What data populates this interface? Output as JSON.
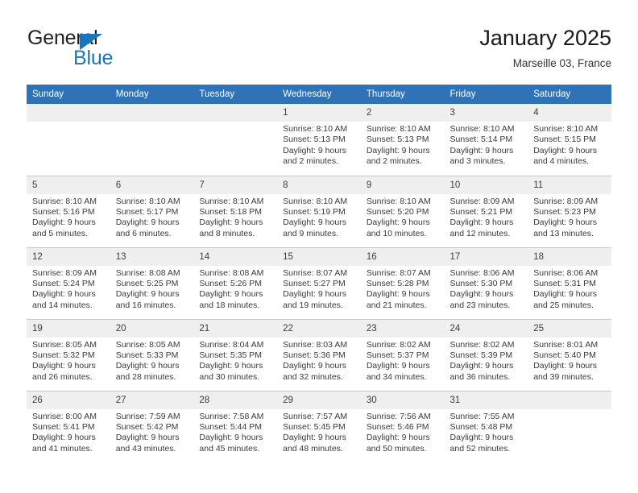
{
  "brand": {
    "name_top": "General",
    "name_bottom": "Blue",
    "triangle_icon": "blue-triangle-icon",
    "color_blue": "#1b75bb",
    "color_dark": "#222222"
  },
  "header": {
    "title": "January 2025",
    "subtitle": "Marseille 03, France"
  },
  "theme": {
    "header_bg": "#2f72b5",
    "header_text": "#ffffff",
    "daynum_bg": "#efefef",
    "cell_bg": "#ffffff",
    "row_divider": "#c7c7c7"
  },
  "weekdays": [
    "Sunday",
    "Monday",
    "Tuesday",
    "Wednesday",
    "Thursday",
    "Friday",
    "Saturday"
  ],
  "labels": {
    "sunrise_prefix": "Sunrise:",
    "sunset_prefix": "Sunset:",
    "daylight_prefix": "Daylight:"
  },
  "weeks": [
    [
      {
        "day": "",
        "empty": true
      },
      {
        "day": "",
        "empty": true
      },
      {
        "day": "",
        "empty": true
      },
      {
        "day": "1",
        "sunrise": "Sunrise: 8:10 AM",
        "sunset": "Sunset: 5:13 PM",
        "daylight_line1": "Daylight: 9 hours",
        "daylight_line2": "and 2 minutes."
      },
      {
        "day": "2",
        "sunrise": "Sunrise: 8:10 AM",
        "sunset": "Sunset: 5:13 PM",
        "daylight_line1": "Daylight: 9 hours",
        "daylight_line2": "and 2 minutes."
      },
      {
        "day": "3",
        "sunrise": "Sunrise: 8:10 AM",
        "sunset": "Sunset: 5:14 PM",
        "daylight_line1": "Daylight: 9 hours",
        "daylight_line2": "and 3 minutes."
      },
      {
        "day": "4",
        "sunrise": "Sunrise: 8:10 AM",
        "sunset": "Sunset: 5:15 PM",
        "daylight_line1": "Daylight: 9 hours",
        "daylight_line2": "and 4 minutes."
      }
    ],
    [
      {
        "day": "5",
        "sunrise": "Sunrise: 8:10 AM",
        "sunset": "Sunset: 5:16 PM",
        "daylight_line1": "Daylight: 9 hours",
        "daylight_line2": "and 5 minutes."
      },
      {
        "day": "6",
        "sunrise": "Sunrise: 8:10 AM",
        "sunset": "Sunset: 5:17 PM",
        "daylight_line1": "Daylight: 9 hours",
        "daylight_line2": "and 6 minutes."
      },
      {
        "day": "7",
        "sunrise": "Sunrise: 8:10 AM",
        "sunset": "Sunset: 5:18 PM",
        "daylight_line1": "Daylight: 9 hours",
        "daylight_line2": "and 8 minutes."
      },
      {
        "day": "8",
        "sunrise": "Sunrise: 8:10 AM",
        "sunset": "Sunset: 5:19 PM",
        "daylight_line1": "Daylight: 9 hours",
        "daylight_line2": "and 9 minutes."
      },
      {
        "day": "9",
        "sunrise": "Sunrise: 8:10 AM",
        "sunset": "Sunset: 5:20 PM",
        "daylight_line1": "Daylight: 9 hours",
        "daylight_line2": "and 10 minutes."
      },
      {
        "day": "10",
        "sunrise": "Sunrise: 8:09 AM",
        "sunset": "Sunset: 5:21 PM",
        "daylight_line1": "Daylight: 9 hours",
        "daylight_line2": "and 12 minutes."
      },
      {
        "day": "11",
        "sunrise": "Sunrise: 8:09 AM",
        "sunset": "Sunset: 5:23 PM",
        "daylight_line1": "Daylight: 9 hours",
        "daylight_line2": "and 13 minutes."
      }
    ],
    [
      {
        "day": "12",
        "sunrise": "Sunrise: 8:09 AM",
        "sunset": "Sunset: 5:24 PM",
        "daylight_line1": "Daylight: 9 hours",
        "daylight_line2": "and 14 minutes."
      },
      {
        "day": "13",
        "sunrise": "Sunrise: 8:08 AM",
        "sunset": "Sunset: 5:25 PM",
        "daylight_line1": "Daylight: 9 hours",
        "daylight_line2": "and 16 minutes."
      },
      {
        "day": "14",
        "sunrise": "Sunrise: 8:08 AM",
        "sunset": "Sunset: 5:26 PM",
        "daylight_line1": "Daylight: 9 hours",
        "daylight_line2": "and 18 minutes."
      },
      {
        "day": "15",
        "sunrise": "Sunrise: 8:07 AM",
        "sunset": "Sunset: 5:27 PM",
        "daylight_line1": "Daylight: 9 hours",
        "daylight_line2": "and 19 minutes."
      },
      {
        "day": "16",
        "sunrise": "Sunrise: 8:07 AM",
        "sunset": "Sunset: 5:28 PM",
        "daylight_line1": "Daylight: 9 hours",
        "daylight_line2": "and 21 minutes."
      },
      {
        "day": "17",
        "sunrise": "Sunrise: 8:06 AM",
        "sunset": "Sunset: 5:30 PM",
        "daylight_line1": "Daylight: 9 hours",
        "daylight_line2": "and 23 minutes."
      },
      {
        "day": "18",
        "sunrise": "Sunrise: 8:06 AM",
        "sunset": "Sunset: 5:31 PM",
        "daylight_line1": "Daylight: 9 hours",
        "daylight_line2": "and 25 minutes."
      }
    ],
    [
      {
        "day": "19",
        "sunrise": "Sunrise: 8:05 AM",
        "sunset": "Sunset: 5:32 PM",
        "daylight_line1": "Daylight: 9 hours",
        "daylight_line2": "and 26 minutes."
      },
      {
        "day": "20",
        "sunrise": "Sunrise: 8:05 AM",
        "sunset": "Sunset: 5:33 PM",
        "daylight_line1": "Daylight: 9 hours",
        "daylight_line2": "and 28 minutes."
      },
      {
        "day": "21",
        "sunrise": "Sunrise: 8:04 AM",
        "sunset": "Sunset: 5:35 PM",
        "daylight_line1": "Daylight: 9 hours",
        "daylight_line2": "and 30 minutes."
      },
      {
        "day": "22",
        "sunrise": "Sunrise: 8:03 AM",
        "sunset": "Sunset: 5:36 PM",
        "daylight_line1": "Daylight: 9 hours",
        "daylight_line2": "and 32 minutes."
      },
      {
        "day": "23",
        "sunrise": "Sunrise: 8:02 AM",
        "sunset": "Sunset: 5:37 PM",
        "daylight_line1": "Daylight: 9 hours",
        "daylight_line2": "and 34 minutes."
      },
      {
        "day": "24",
        "sunrise": "Sunrise: 8:02 AM",
        "sunset": "Sunset: 5:39 PM",
        "daylight_line1": "Daylight: 9 hours",
        "daylight_line2": "and 36 minutes."
      },
      {
        "day": "25",
        "sunrise": "Sunrise: 8:01 AM",
        "sunset": "Sunset: 5:40 PM",
        "daylight_line1": "Daylight: 9 hours",
        "daylight_line2": "and 39 minutes."
      }
    ],
    [
      {
        "day": "26",
        "sunrise": "Sunrise: 8:00 AM",
        "sunset": "Sunset: 5:41 PM",
        "daylight_line1": "Daylight: 9 hours",
        "daylight_line2": "and 41 minutes."
      },
      {
        "day": "27",
        "sunrise": "Sunrise: 7:59 AM",
        "sunset": "Sunset: 5:42 PM",
        "daylight_line1": "Daylight: 9 hours",
        "daylight_line2": "and 43 minutes."
      },
      {
        "day": "28",
        "sunrise": "Sunrise: 7:58 AM",
        "sunset": "Sunset: 5:44 PM",
        "daylight_line1": "Daylight: 9 hours",
        "daylight_line2": "and 45 minutes."
      },
      {
        "day": "29",
        "sunrise": "Sunrise: 7:57 AM",
        "sunset": "Sunset: 5:45 PM",
        "daylight_line1": "Daylight: 9 hours",
        "daylight_line2": "and 48 minutes."
      },
      {
        "day": "30",
        "sunrise": "Sunrise: 7:56 AM",
        "sunset": "Sunset: 5:46 PM",
        "daylight_line1": "Daylight: 9 hours",
        "daylight_line2": "and 50 minutes."
      },
      {
        "day": "31",
        "sunrise": "Sunrise: 7:55 AM",
        "sunset": "Sunset: 5:48 PM",
        "daylight_line1": "Daylight: 9 hours",
        "daylight_line2": "and 52 minutes."
      },
      {
        "day": "",
        "empty": true
      }
    ]
  ]
}
